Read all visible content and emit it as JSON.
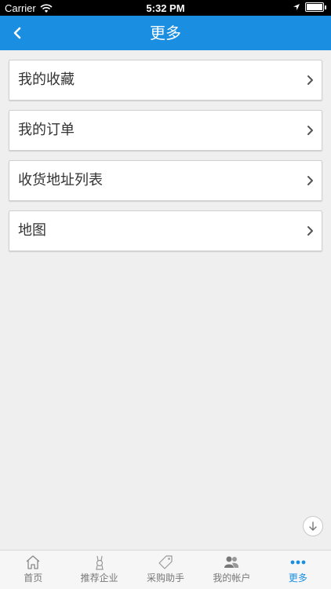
{
  "status_bar": {
    "carrier": "Carrier",
    "time": "5:32 PM"
  },
  "nav": {
    "title": "更多"
  },
  "menu": {
    "items": [
      {
        "label": "我的收藏"
      },
      {
        "label": "我的订单"
      },
      {
        "label": "收货地址列表"
      },
      {
        "label": "地图"
      }
    ]
  },
  "tabbar": {
    "tabs": [
      {
        "label": "首页",
        "icon": "home-icon"
      },
      {
        "label": "推荐企业",
        "icon": "rabbit-icon"
      },
      {
        "label": "采购助手",
        "icon": "tag-icon"
      },
      {
        "label": "我的帐户",
        "icon": "users-icon"
      },
      {
        "label": "更多",
        "icon": "more-dots-icon",
        "active": true
      }
    ]
  },
  "colors": {
    "accent": "#1a8ee0",
    "background": "#efeff0"
  }
}
